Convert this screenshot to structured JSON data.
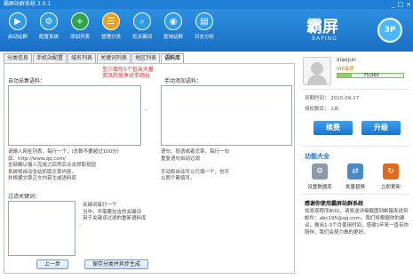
{
  "window": {
    "title": "霸屏站群系统 3.0.1",
    "controls": [
      "_",
      "□",
      "×"
    ]
  },
  "toolbar": {
    "items": [
      {
        "label": "启动站群",
        "glyph": "▶",
        "color": "#2e9be8"
      },
      {
        "label": "配置系统",
        "glyph": "⚙",
        "color": "#2e9be8"
      },
      {
        "label": "添加列表",
        "glyph": "+",
        "color": "#2ea64a"
      },
      {
        "label": "管理分类",
        "glyph": "☰",
        "color": "#e8a020"
      },
      {
        "label": "挖关键词",
        "glyph": "⌕",
        "color": "#2e9be8"
      },
      {
        "label": "查询站群",
        "glyph": "◉",
        "color": "#2e9be8"
      },
      {
        "label": "日志分析",
        "glyph": "▤",
        "color": "#2e9be8"
      }
    ],
    "brand_cn": "霸屏",
    "brand_en": "BAPING",
    "brand_badge": "3P"
  },
  "tabs": [
    {
      "label": "分类信息",
      "active": false
    },
    {
      "label": "手机站配置",
      "active": false
    },
    {
      "label": "域名列表",
      "active": false
    },
    {
      "label": "关键词列表",
      "active": false
    },
    {
      "label": "地区列表",
      "active": false
    },
    {
      "label": "语料库",
      "active": true
    }
  ],
  "panel": {
    "warning_line1": "至少填写5个包含大量",
    "warning_line2": "资讯的竞争对手网址",
    "auto_label": "自动采集语料：",
    "manual_label": "手动添加语料：",
    "auto_note": "请输入网址列表，每行一个，(总数不要超过100分)\n如：http://www.qq.com/\n全部确认输入完成之后然后点击抓取按钮\n系统将自动全站抓取文章内容，\n并根据文章正文内容生成语料库",
    "manual_note": "语句、短语或者文章，每行一句\n重复语句自动过滤\n\n手动和自动可以只填一个，也可\n以两个都填写。",
    "filter_label": "过滤关键词：",
    "filter_note": "关键词每行一个\n当中，不需要包含的关键词\n用于关键词过滤的重新语料库",
    "prev_button": "上一步",
    "save_button": "保存分类并异步生成"
  },
  "sidebar": {
    "username": "xiaojun",
    "vip": "VIP会员",
    "progress_text": "75/365",
    "progress_fraction": 0.21,
    "expire_label": "到期时间：",
    "expire_value": "2015-09-17",
    "auth_label": "授权数目：",
    "auth_value": "1台",
    "renew_button": "续费",
    "upgrade_button": "升级",
    "functions_title": "功能大全",
    "functions": [
      {
        "label": "设置数据库",
        "glyph": "⚙",
        "color": "#8a9aaa"
      },
      {
        "label": "批量替换",
        "glyph": "⇄",
        "color": "#4a8ac8"
      },
      {
        "label": "立即更新",
        "glyph": "↻",
        "color": "#e06a20"
      }
    ],
    "notice_title": "感谢你使用霸屏站群系统",
    "notice_text": "如发现程序BUG，请发送详细截图到邮箱发送到邮件：abc195@qq.com，我们将根据你的建议，做出1-3个月使用时间，感谢1年来一直有你陪伴，我们会努力做的更好。"
  }
}
